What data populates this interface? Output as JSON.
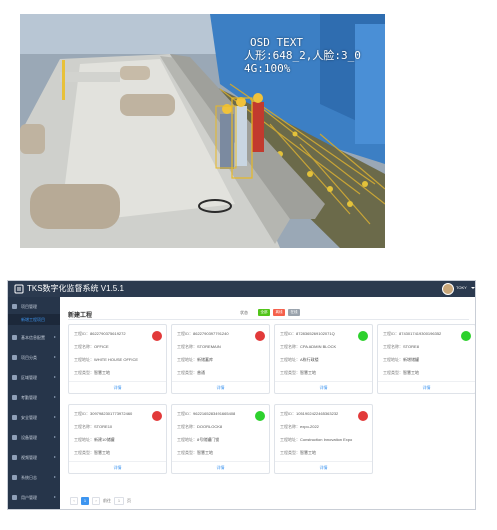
{
  "camera": {
    "osd_title": "OSD TEXT",
    "osd_line1": "人形:648_2,人脸:3_0",
    "osd_line2": "4G:100%"
  },
  "app": {
    "title": "TKS数字化监督系统 V1.5.1",
    "user_name": "TOKY"
  },
  "sidebar": {
    "items": [
      {
        "label": "项目管理",
        "icon": "folder-icon"
      },
      {
        "label": "新增工程项目",
        "icon": ""
      },
      {
        "label": "基本信息配置",
        "icon": "settings-icon"
      },
      {
        "label": "项目分类",
        "icon": "list-icon"
      },
      {
        "label": "区域管理",
        "icon": "map-icon"
      },
      {
        "label": "考勤管理",
        "icon": "clock-icon"
      },
      {
        "label": "安全管理",
        "icon": "shield-icon"
      },
      {
        "label": "设备管理",
        "icon": "device-icon"
      },
      {
        "label": "视频管理",
        "icon": "video-icon"
      },
      {
        "label": "系统日志",
        "icon": "log-icon"
      },
      {
        "label": "用户管理",
        "icon": "user-icon"
      }
    ]
  },
  "main": {
    "page_title": "新建工程",
    "filter_label": "状态",
    "filters": [
      {
        "label": "全部",
        "color": "#52c41a"
      },
      {
        "label": "离线",
        "color": "#f5604b"
      },
      {
        "label": "在线",
        "color": "#9aa3ad"
      }
    ],
    "field_labels": {
      "id": "工程ID：",
      "name": "工程名称：",
      "address": "工程地址：",
      "type": "工程类型："
    },
    "cards": [
      {
        "id": "8622790375619272",
        "name": "OFFICE",
        "address": "WHITE HOUSE OFFICE",
        "type": "智慧工地",
        "status": "offline",
        "dot_color": "#e23a3a",
        "action": "详情"
      },
      {
        "id": "8622790397791240",
        "name": "STOREMAIN",
        "address": "新储蓄库",
        "type": "普通",
        "status": "offline",
        "dot_color": "#e23a3a",
        "action": "详情"
      },
      {
        "id": "8728365269102071Q",
        "name": "CPA ADMIN BLOCK",
        "address": "A栋行政楼",
        "type": "智慧工地",
        "status": "online",
        "dot_color": "#2dd12d",
        "action": "详情"
      },
      {
        "id": "8743017419300196352",
        "name": "STORE8",
        "address": "新增储罐",
        "type": "智慧工地",
        "status": "online",
        "dot_color": "#2dd12d",
        "action": "详情"
      },
      {
        "id": "3097982301773972460",
        "name": "STORE10",
        "address": "新建10储罐",
        "type": "智慧工地",
        "status": "offline",
        "dot_color": "#e23a3a",
        "action": "详情"
      },
      {
        "id": "9622165283491665408",
        "name": "DOORLOCK8",
        "address": "8号储罐门锁",
        "type": "智慧工地",
        "status": "online",
        "dot_color": "#2dd12d",
        "action": "详情"
      },
      {
        "id": "1051902422465363232",
        "name": "expo-2022",
        "address": "Construction Innovation Expo",
        "type": "智慧工地",
        "status": "offline",
        "dot_color": "#e23a3a",
        "action": "详情"
      }
    ]
  },
  "pagination": {
    "prev": "‹",
    "current": "1",
    "next": "›",
    "goto_label": "前往",
    "goto_value": "1",
    "page_unit": "页"
  }
}
